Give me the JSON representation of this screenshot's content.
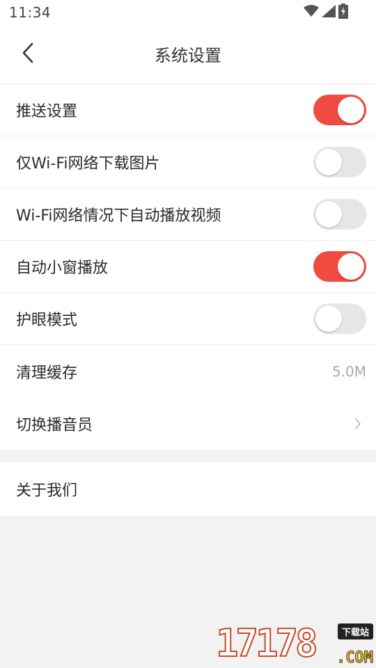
{
  "status_bar": {
    "time": "11:34",
    "icons": [
      "wifi-icon",
      "cell-signal-icon",
      "battery-charging-icon"
    ]
  },
  "header": {
    "title": "系统设置",
    "back_icon": "chevron-left-icon"
  },
  "settings": [
    {
      "label": "推送设置",
      "type": "toggle",
      "on": true
    },
    {
      "label": "仅Wi-Fi网络下载图片",
      "type": "toggle",
      "on": false
    },
    {
      "label": "Wi-Fi网络情况下自动播放视频",
      "type": "toggle",
      "on": false
    },
    {
      "label": "自动小窗播放",
      "type": "toggle",
      "on": true
    },
    {
      "label": "护眼模式",
      "type": "toggle",
      "on": false
    },
    {
      "label": "清理缓存",
      "type": "value",
      "value": "5.0M"
    },
    {
      "label": "切换播音员",
      "type": "link",
      "icon": "chevron-right-icon"
    }
  ],
  "about": {
    "label": "关于我们"
  },
  "watermark": {
    "digits": "17178",
    "tag": "下载站",
    "domain": ".COM"
  },
  "colors": {
    "toggle_on": "#f04a41",
    "toggle_off": "#e6e6e6",
    "background": "#f2f2f2"
  }
}
